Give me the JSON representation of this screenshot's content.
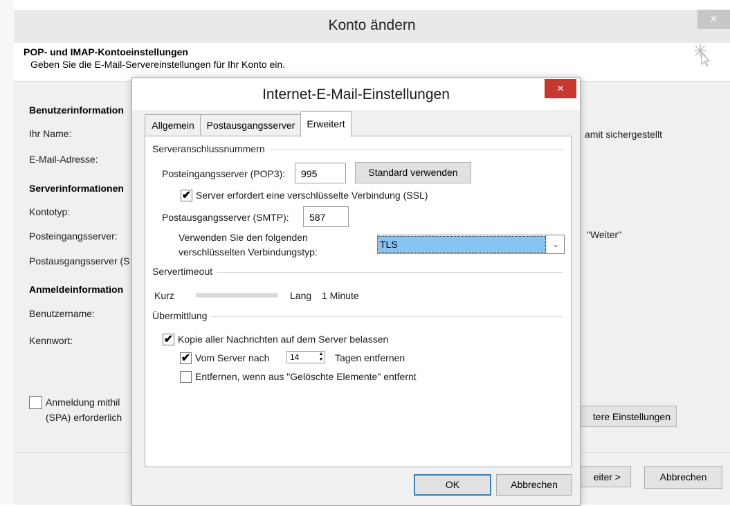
{
  "outer": {
    "title": "Konto ändern",
    "close_glyph": "×",
    "heading": "POP- und IMAP-Kontoeinstellungen",
    "subheading": "Geben Sie die E-Mail-Servereinstellungen für Ihr Konto ein.",
    "sections": {
      "user_info": "Benutzerinformation",
      "server_info": "Serverinformationen",
      "login_info": "Anmeldeinformation"
    },
    "labels": {
      "name": "Ihr Name:",
      "email": "E-Mail-Adresse:",
      "account_type": "Kontotyp:",
      "incoming": "Posteingangsserver:",
      "outgoing": "Postausgangsserver (S",
      "username": "Benutzername:",
      "password": "Kennwort:"
    },
    "spa_label_line1": "Anmeldung mithil",
    "spa_label_line2": "(SPA) erforderlich",
    "right_text_1": "amit sichergestellt",
    "right_text_2": "\"Weiter\"",
    "more_settings_button": "tere Einstellungen",
    "next_button": "eiter >",
    "cancel_button": "Abbrechen"
  },
  "dialog": {
    "title": "Internet-E-Mail-Einstellungen",
    "close_glyph": "×",
    "tabs": [
      {
        "label": "Allgemein",
        "active": false
      },
      {
        "label": "Postausgangsserver",
        "active": false
      },
      {
        "label": "Erweitert",
        "active": true
      }
    ],
    "ports_group": "Serveranschlussnummern",
    "incoming_label": "Posteingangsserver (POP3):",
    "incoming_port": "995",
    "default_button": "Standard verwenden",
    "ssl_checkbox": {
      "label": "Server erfordert eine verschlüsselte Verbindung (SSL)",
      "checked": true
    },
    "outgoing_label": "Postausgangsserver (SMTP):",
    "outgoing_port": "587",
    "encryption_label_line1": "Verwenden Sie den folgenden",
    "encryption_label_line2": "verschlüsselten Verbindungstyp:",
    "encryption_value": "TLS",
    "timeout_group": "Servertimeout",
    "timeout_short": "Kurz",
    "timeout_long": "Lang",
    "timeout_value": "1 Minute",
    "delivery_group": "Übermittlung",
    "keep_copy": {
      "label": "Kopie aller Nachrichten auf dem Server belassen",
      "checked": true
    },
    "remove_after": {
      "label_before": "Vom Server nach",
      "days": "14",
      "label_after": "Tagen entfernen",
      "checked": true
    },
    "remove_deleted": {
      "label": "Entfernen, wenn aus \"Gelöschte Elemente\" entfernt",
      "checked": false
    },
    "ok_button": "OK",
    "cancel_button": "Abbrechen"
  },
  "icons": {
    "check": "✔",
    "dropdown": "⌄",
    "spin_up": "▲",
    "spin_down": "▼"
  },
  "colors": {
    "selection": "#88c4f2",
    "close_red": "#c7392f",
    "ok_focus": "#3c7fb1"
  }
}
